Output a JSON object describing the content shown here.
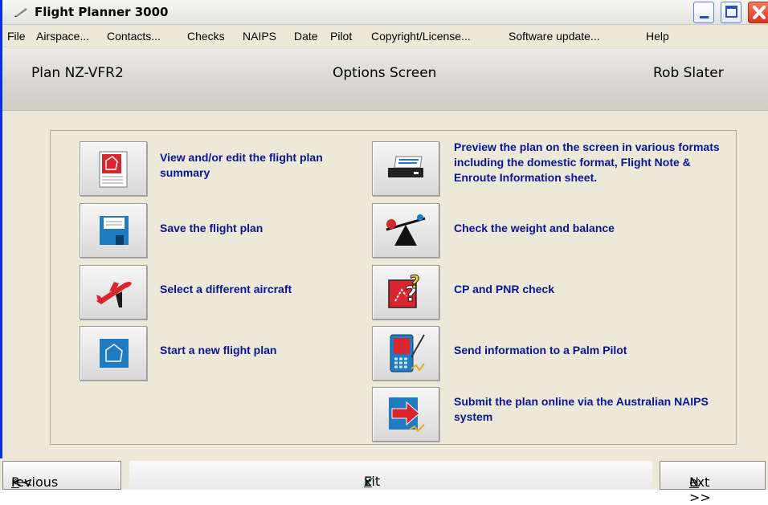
{
  "window": {
    "title": "Flight Planner 3000"
  },
  "menu": [
    "File",
    "Airspace...",
    "Contacts...",
    "Checks",
    "NAIPS",
    "Date",
    "Pilot",
    "Copyright/License...",
    "Software update...",
    "Help"
  ],
  "header": {
    "plan": "Plan NZ-VFR2",
    "screen": "Options Screen",
    "user": "Rob Slater"
  },
  "options_left": [
    {
      "label": "View and/or edit the flight plan summary",
      "icon": "document-icon"
    },
    {
      "label": "Save the flight plan",
      "icon": "floppy-disk-icon"
    },
    {
      "label": "Select a different aircraft",
      "icon": "airplane-icon"
    },
    {
      "label": "Start a new flight plan",
      "icon": "new-plan-icon"
    }
  ],
  "options_right": [
    {
      "label": "Preview the plan on the screen in various formats including the domestic format, Flight Note & Enroute Information sheet.",
      "icon": "printer-icon"
    },
    {
      "label": "Check the weight and balance",
      "icon": "seesaw-icon"
    },
    {
      "label": "CP and PNR check",
      "icon": "question-map-icon"
    },
    {
      "label": "Send information to a Palm Pilot",
      "icon": "palm-device-icon"
    },
    {
      "label": "Submit the plan online via the Australian NAIPS system",
      "icon": "submit-arrow-icon"
    }
  ],
  "footer": {
    "previous_prefix": "<< ",
    "previous_key": "P",
    "previous_rest": "revious",
    "exit_key": "E",
    "exit_rest": "xit",
    "next_key": "N",
    "next_rest": "ext >>"
  },
  "colors": {
    "label_blue": "#0b1496",
    "icon_red": "#d8252e",
    "icon_blue": "#1f7bc2"
  }
}
